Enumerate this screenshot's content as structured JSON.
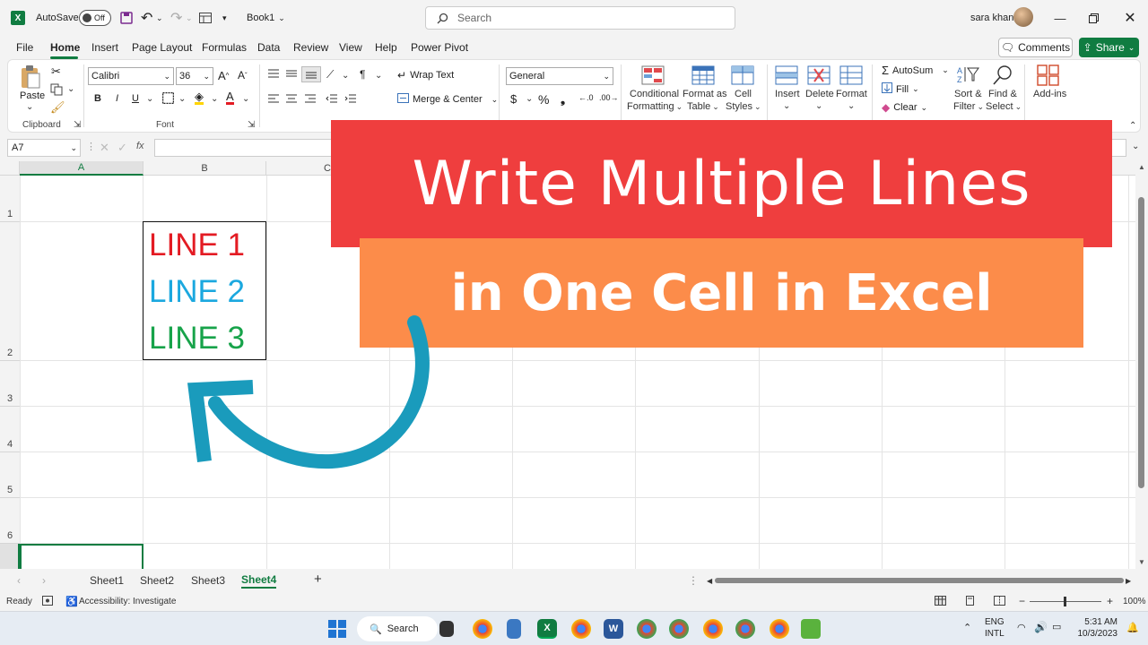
{
  "titlebar": {
    "autosave_label": "AutoSave",
    "autosave_state": "Off",
    "book_name": "Book1",
    "search_placeholder": "Search",
    "user_name": "sara khan"
  },
  "tabs": [
    "File",
    "Home",
    "Insert",
    "Page Layout",
    "Formulas",
    "Data",
    "Review",
    "View",
    "Help",
    "Power Pivot"
  ],
  "active_tab": "Home",
  "actions": {
    "comments": "Comments",
    "share": "Share"
  },
  "ribbon": {
    "clipboard": {
      "paste": "Paste",
      "group": "Clipboard"
    },
    "font": {
      "name": "Calibri",
      "size": "36",
      "group": "Font",
      "bold": "B",
      "italic": "I",
      "underline": "U"
    },
    "alignment": {
      "wrap": "Wrap Text",
      "merge": "Merge & Center"
    },
    "number": {
      "format": "General"
    },
    "styles": {
      "conditional1": "Conditional",
      "conditional2": "Formatting",
      "format_table1": "Format as",
      "format_table2": "Table",
      "cell_styles1": "Cell",
      "cell_styles2": "Styles"
    },
    "cells": {
      "insert": "Insert",
      "delete": "Delete",
      "format": "Format"
    },
    "editing": {
      "autosum": "AutoSum",
      "fill": "Fill",
      "clear": "Clear",
      "sort1": "Sort &",
      "sort2": "Filter",
      "find1": "Find &",
      "find2": "Select"
    },
    "addins": "Add-ins"
  },
  "formula_bar": {
    "name_box": "A7",
    "fx": "fx"
  },
  "columns": [
    "A",
    "B",
    "C"
  ],
  "rows": [
    "1",
    "2",
    "3",
    "4",
    "5",
    "6"
  ],
  "cell_b2": {
    "lines": [
      "LINE 1",
      "LINE 2",
      "LINE 3"
    ],
    "colors": [
      "#e31b23",
      "#1ba8df",
      "#17a34a"
    ]
  },
  "overlay": {
    "title_line1": "Write Multiple Lines",
    "title_line2": "in One Cell in Excel",
    "color1": "#ef3e3e",
    "color2": "#fc8c4a",
    "arrow_color": "#1a9bbc"
  },
  "sheets": [
    "Sheet1",
    "Sheet2",
    "Sheet3",
    "Sheet4"
  ],
  "active_sheet": "Sheet4",
  "status": {
    "ready": "Ready",
    "accessibility": "Accessibility: Investigate",
    "zoom": "100%"
  },
  "taskbar": {
    "search": "Search",
    "lang1": "ENG",
    "lang2": "INTL",
    "time": "5:31 AM",
    "date": "10/3/2023"
  }
}
